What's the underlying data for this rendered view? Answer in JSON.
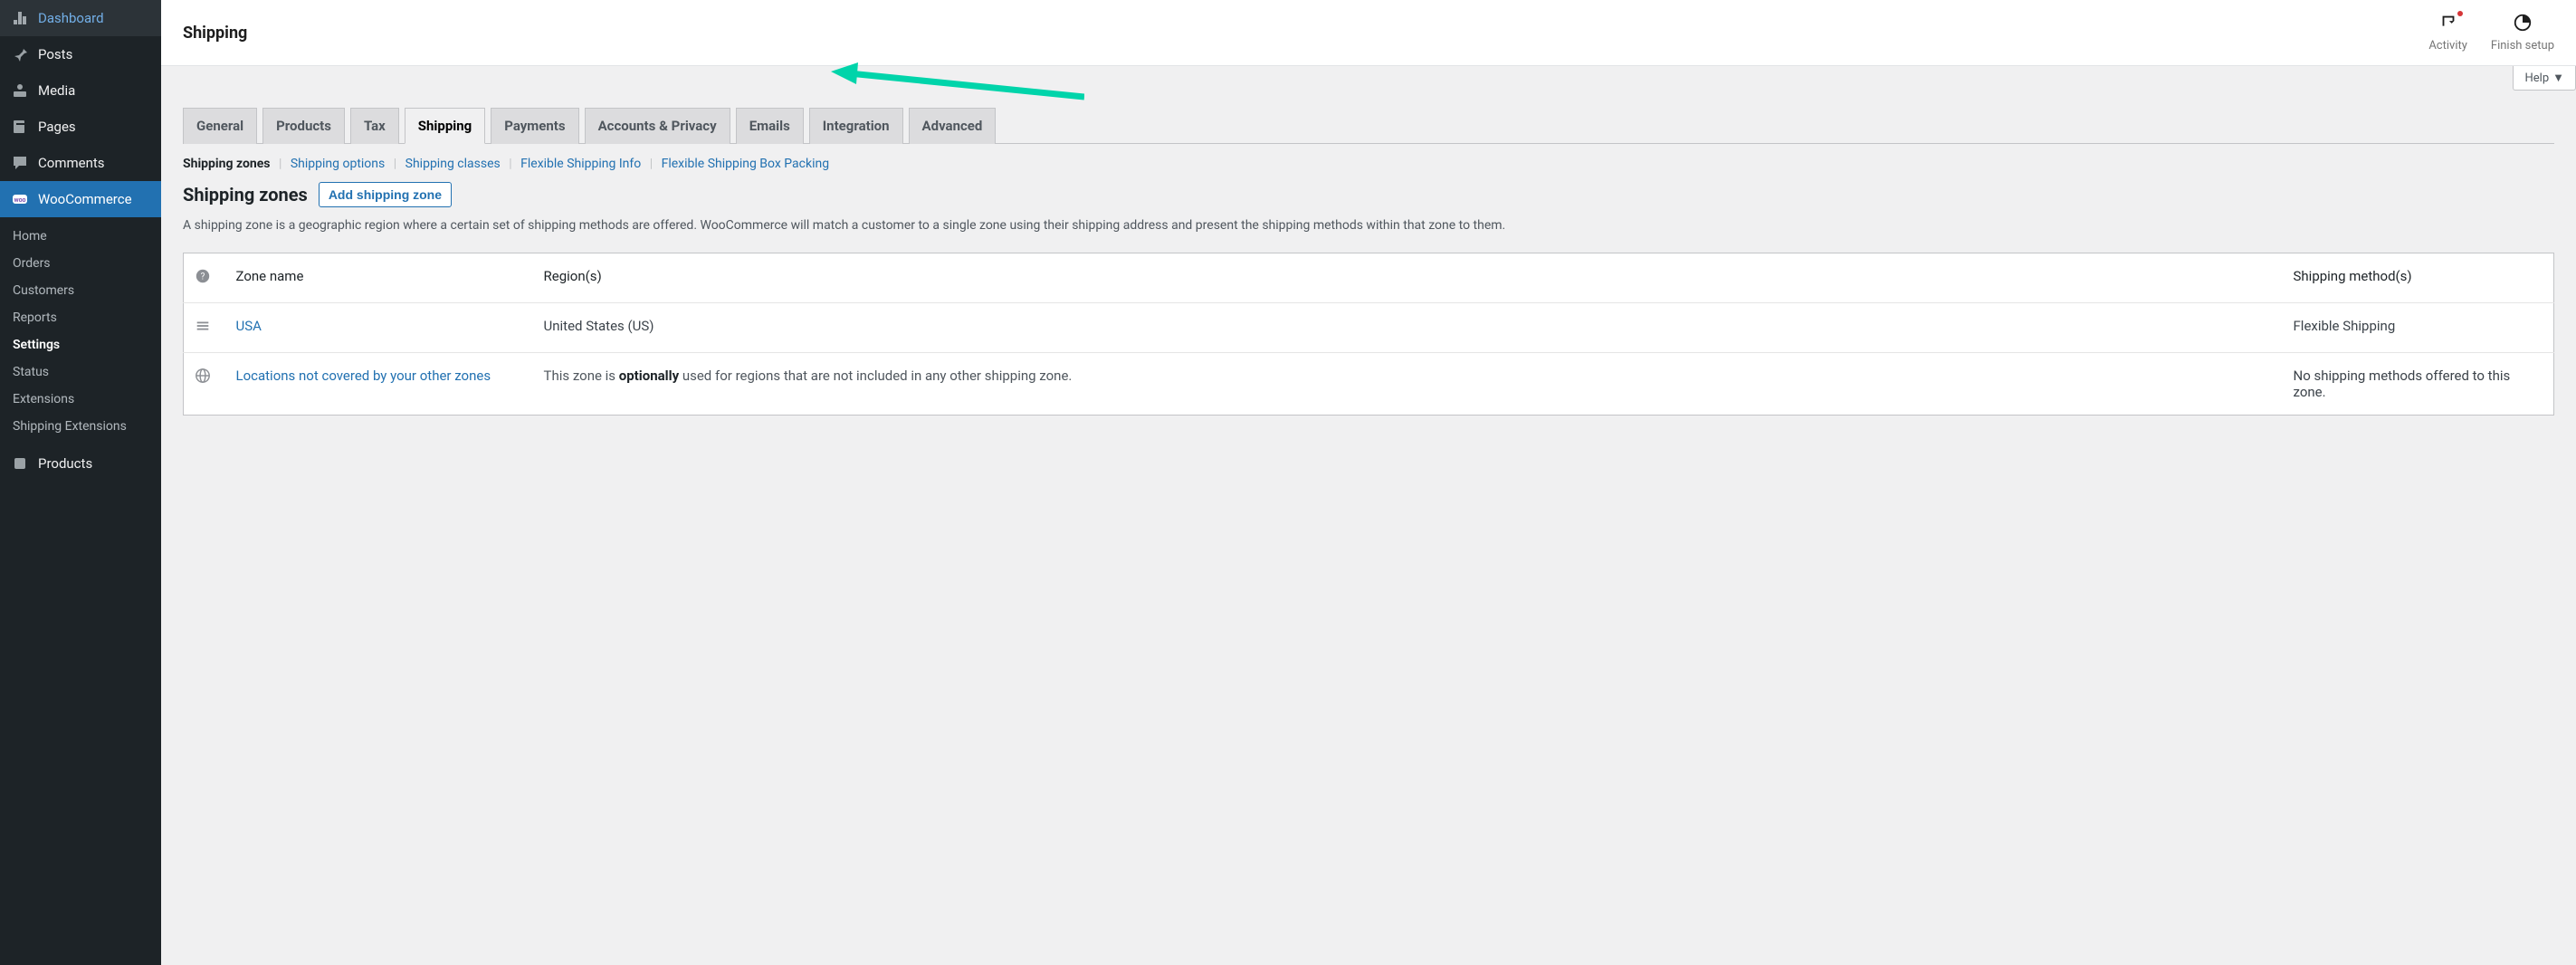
{
  "sidebar": {
    "items": [
      {
        "icon": "dashboard",
        "label": "Dashboard"
      },
      {
        "icon": "pin",
        "label": "Posts"
      },
      {
        "icon": "media",
        "label": "Media"
      },
      {
        "icon": "page",
        "label": "Pages"
      },
      {
        "icon": "comment",
        "label": "Comments"
      },
      {
        "icon": "woo",
        "label": "WooCommerce",
        "current": true
      },
      {
        "icon": "product",
        "label": "Products"
      }
    ],
    "woo_sub": [
      "Home",
      "Orders",
      "Customers",
      "Reports",
      "Settings",
      "Status",
      "Extensions",
      "Shipping Extensions"
    ],
    "woo_sub_current": "Settings"
  },
  "topbar": {
    "title": "Shipping",
    "activity_label": "Activity",
    "finish_label": "Finish setup"
  },
  "help_label": "Help",
  "tabs": [
    "General",
    "Products",
    "Tax",
    "Shipping",
    "Payments",
    "Accounts & Privacy",
    "Emails",
    "Integration",
    "Advanced"
  ],
  "tabs_active": "Shipping",
  "subsections": [
    "Shipping zones",
    "Shipping options",
    "Shipping classes",
    "Flexible Shipping Info",
    "Flexible Shipping Box Packing"
  ],
  "subsections_active": "Shipping zones",
  "section": {
    "heading": "Shipping zones",
    "add_button": "Add shipping zone",
    "description": "A shipping zone is a geographic region where a certain set of shipping methods are offered. WooCommerce will match a customer to a single zone using their shipping address and present the shipping methods within that zone to them."
  },
  "table": {
    "headers": {
      "name": "Zone name",
      "region": "Region(s)",
      "methods": "Shipping method(s)"
    },
    "rows": [
      {
        "handle": "drag",
        "name": "USA",
        "region": "United States (US)",
        "methods": "Flexible Shipping"
      }
    ],
    "fallback": {
      "name": "Locations not covered by your other zones",
      "region_pre": "This zone is ",
      "region_bold": "optionally",
      "region_post": " used for regions that are not included in any other shipping zone.",
      "methods": "No shipping methods offered to this zone."
    }
  }
}
